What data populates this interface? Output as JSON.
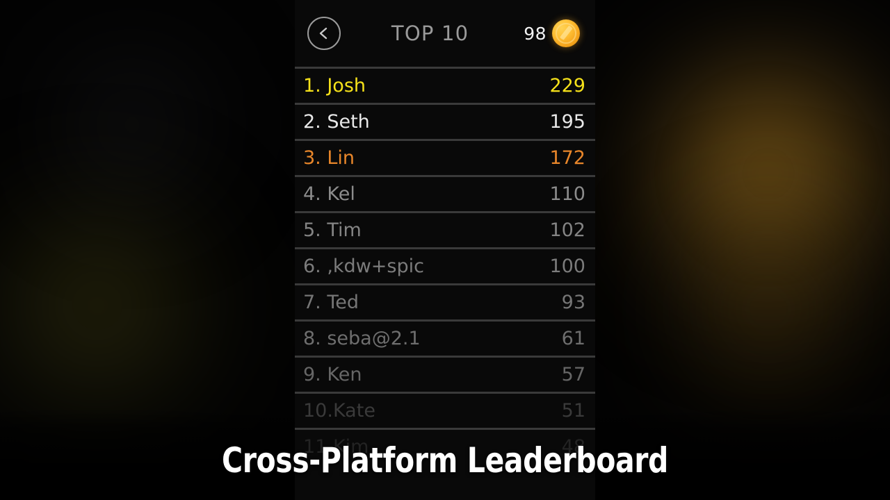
{
  "app": {
    "title": "TOP 10"
  },
  "header": {
    "back_icon": "chevron-left-icon",
    "title": "TOP 10",
    "coin_count": "98",
    "coin_icon": "coin-icon"
  },
  "leaderboard": {
    "rows": [
      {
        "rank": "1. ",
        "name": "Josh",
        "score": "229",
        "color": "#f5e11a"
      },
      {
        "rank": "2. ",
        "name": "Seth",
        "score": "195",
        "color": "#e8e8e8"
      },
      {
        "rank": "3. ",
        "name": "Lin",
        "score": "172",
        "color": "#e8862a"
      },
      {
        "rank": "4. ",
        "name": "Kel",
        "score": "110",
        "color": "#8c8c8c"
      },
      {
        "rank": "5. ",
        "name": "Tim",
        "score": "102",
        "color": "#848484"
      },
      {
        "rank": "6. ",
        "name": ",kdw+spic",
        "score": "100",
        "color": "#7c7c7c"
      },
      {
        "rank": "7. ",
        "name": "Ted",
        "score": "93",
        "color": "#767676"
      },
      {
        "rank": "8. ",
        "name": "seba@2.1",
        "score": "61",
        "color": "#6e6e6e"
      },
      {
        "rank": "9. ",
        "name": "Ken",
        "score": "57",
        "color": "#666666"
      },
      {
        "rank": "10.",
        "name": "Kate",
        "score": "51",
        "color": "#3a3a3a"
      },
      {
        "rank": "11.",
        "name": "Kim",
        "score": "48",
        "color": "#232323"
      }
    ]
  },
  "caption": {
    "text": "Cross-Platform Leaderboard"
  },
  "theme": {
    "panel_bg": "#090909",
    "divider": "#3a3a3a",
    "gold": "#f5e11a",
    "orange": "#e8862a",
    "coin_gold": "#ffc136"
  }
}
